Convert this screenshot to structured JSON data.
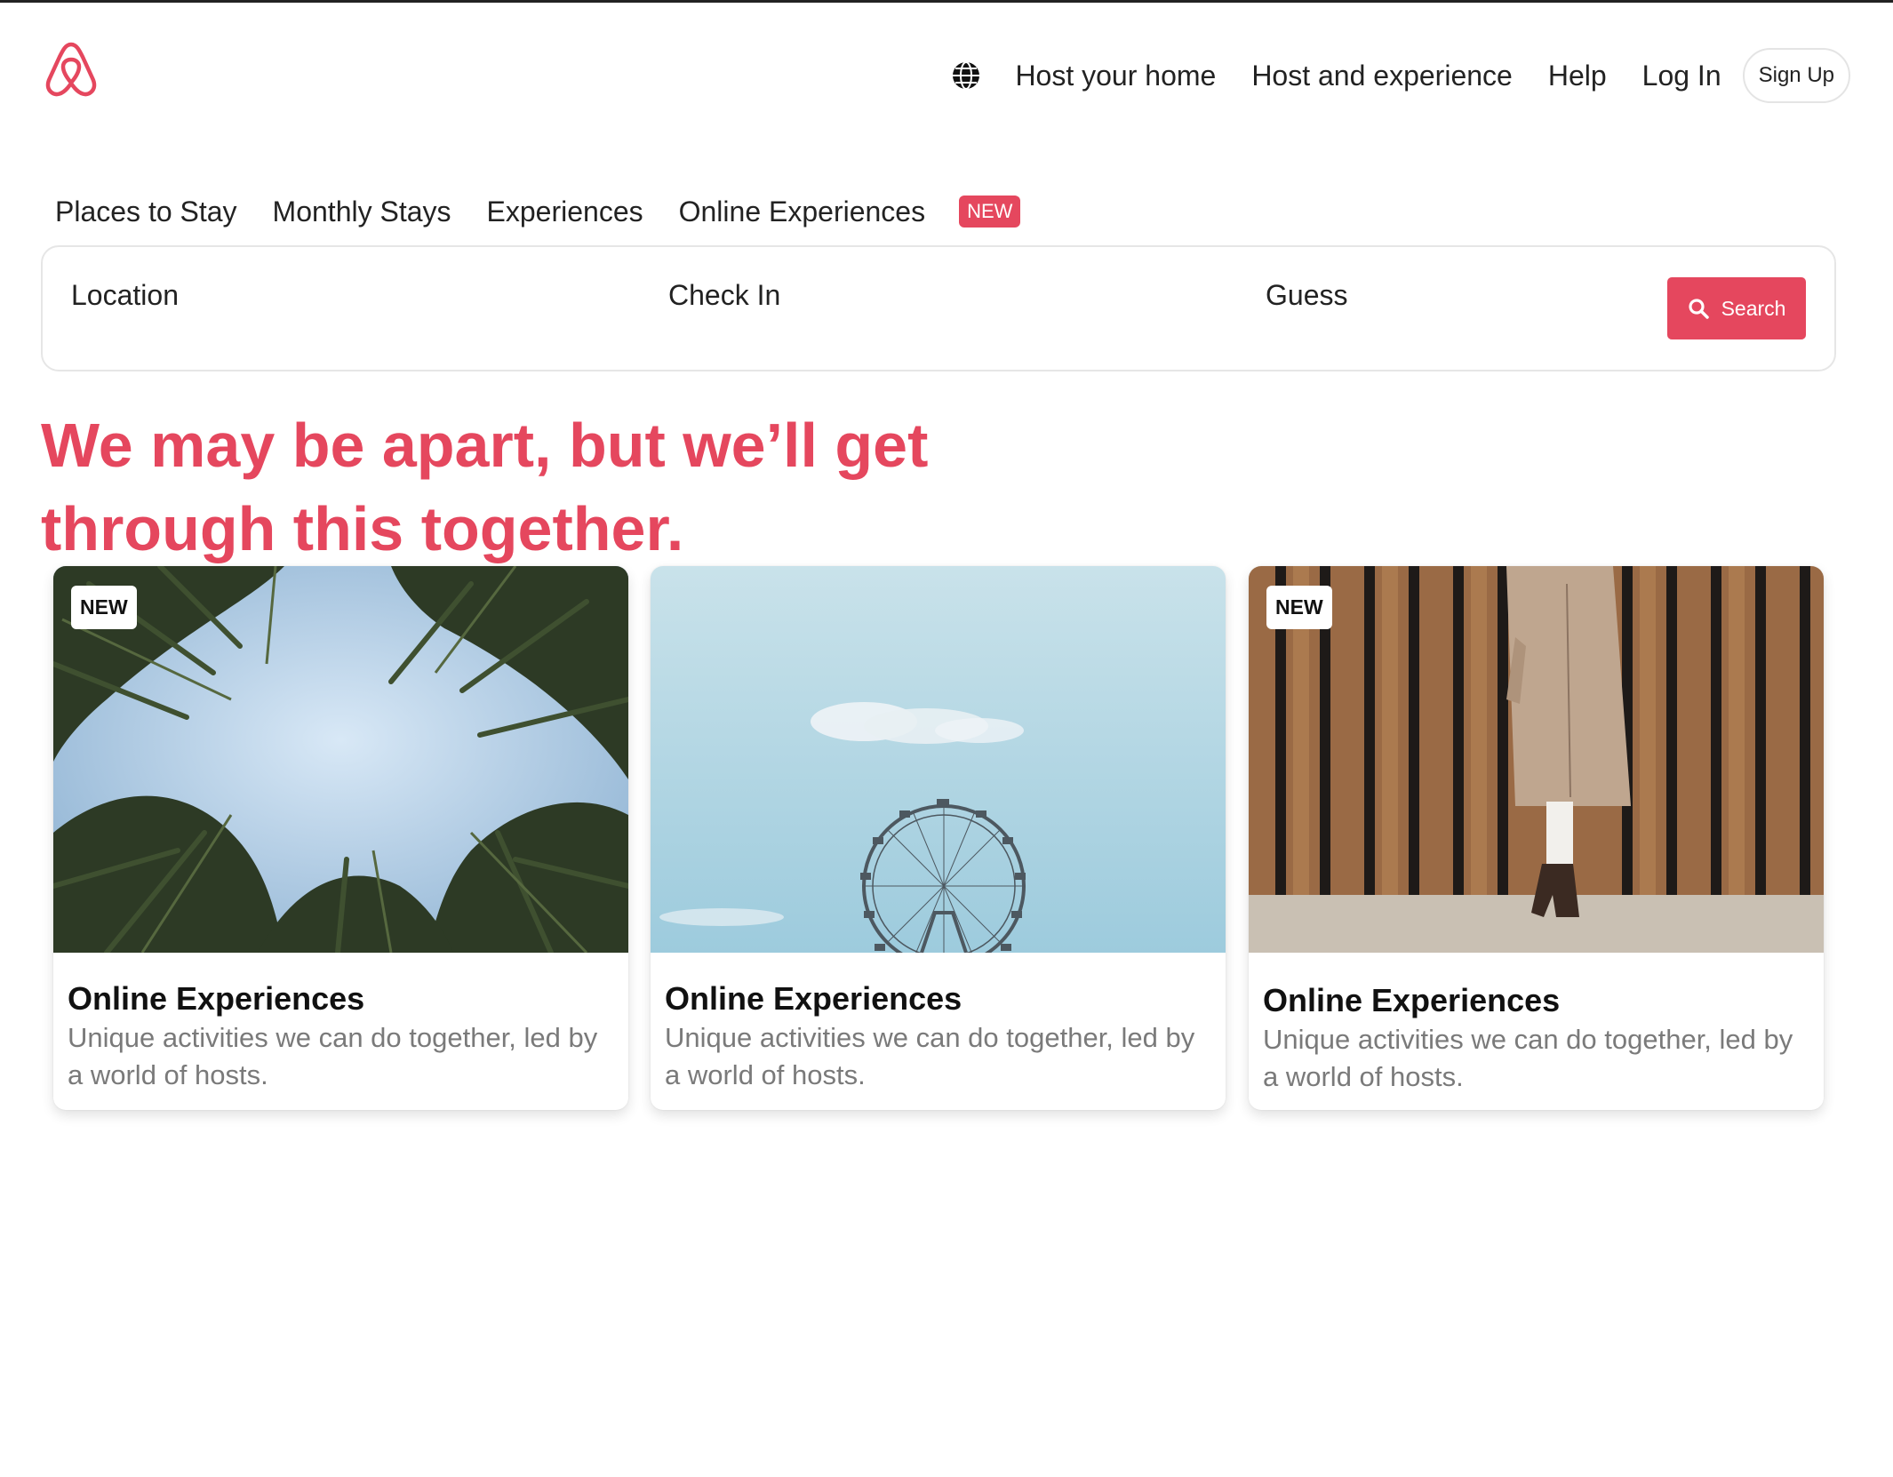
{
  "header": {
    "logo_icon": "airbnb-logo-icon",
    "globe_icon": "globe-icon",
    "links": [
      "Host your home",
      "Host and experience",
      "Help",
      "Log In"
    ],
    "signup_label": "Sign Up"
  },
  "tabs": {
    "items": [
      "Places to Stay",
      "Monthly Stays",
      "Experiences",
      "Online Experiences"
    ],
    "new_badge": "NEW"
  },
  "search": {
    "location_label": "Location",
    "checkin_label": "Check In",
    "guest_label": "Guess",
    "button_label": "Search",
    "button_icon": "search-icon"
  },
  "hero": {
    "line1": "We may be apart, but we’ll get",
    "line2": "through this together."
  },
  "cards": [
    {
      "badge": "NEW",
      "title": "Online Experiences",
      "description": "Unique activities we can do together, led by a world of hosts.",
      "image": "palm-trees-photo"
    },
    {
      "badge": "",
      "title": "Online Experiences",
      "description": "Unique activities we can do together, led by a world of hosts.",
      "image": "ferris-wheel-photo"
    },
    {
      "badge": "NEW",
      "title": "Online Experiences",
      "description": "Unique activities we can do together, led by a world of hosts.",
      "image": "person-coat-photo"
    }
  ],
  "colors": {
    "brand": "#e5475e",
    "text": "#222222",
    "muted": "#7a7a7a"
  }
}
